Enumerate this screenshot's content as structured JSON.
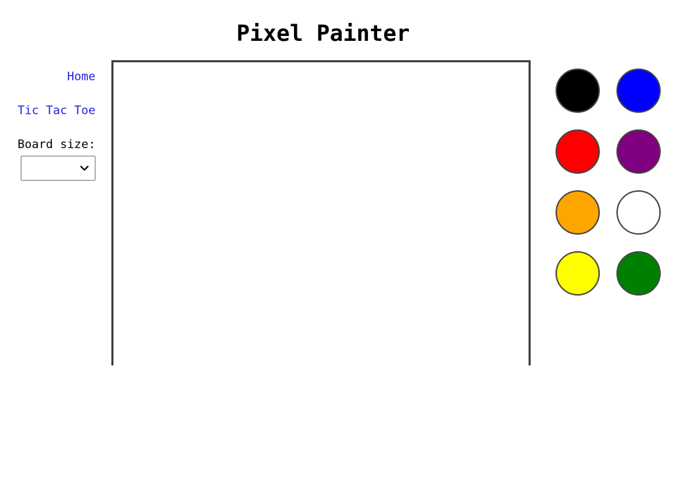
{
  "title": "Pixel Painter",
  "nav": {
    "home": "Home",
    "tic_tac_toe": "Tic Tac Toe"
  },
  "board": {
    "label": "Board size:",
    "selected": ""
  },
  "palette": [
    {
      "name": "black",
      "color": "#000000"
    },
    {
      "name": "blue",
      "color": "#0000ff"
    },
    {
      "name": "red",
      "color": "#ff0000"
    },
    {
      "name": "purple",
      "color": "#800080"
    },
    {
      "name": "orange",
      "color": "#ffa500"
    },
    {
      "name": "white",
      "color": "#ffffff"
    },
    {
      "name": "yellow",
      "color": "#ffff00"
    },
    {
      "name": "green",
      "color": "#008000"
    }
  ],
  "colors": {
    "link": "#2222dd",
    "canvas_border": "#3b3f3f",
    "swatch_border": "#444444"
  }
}
